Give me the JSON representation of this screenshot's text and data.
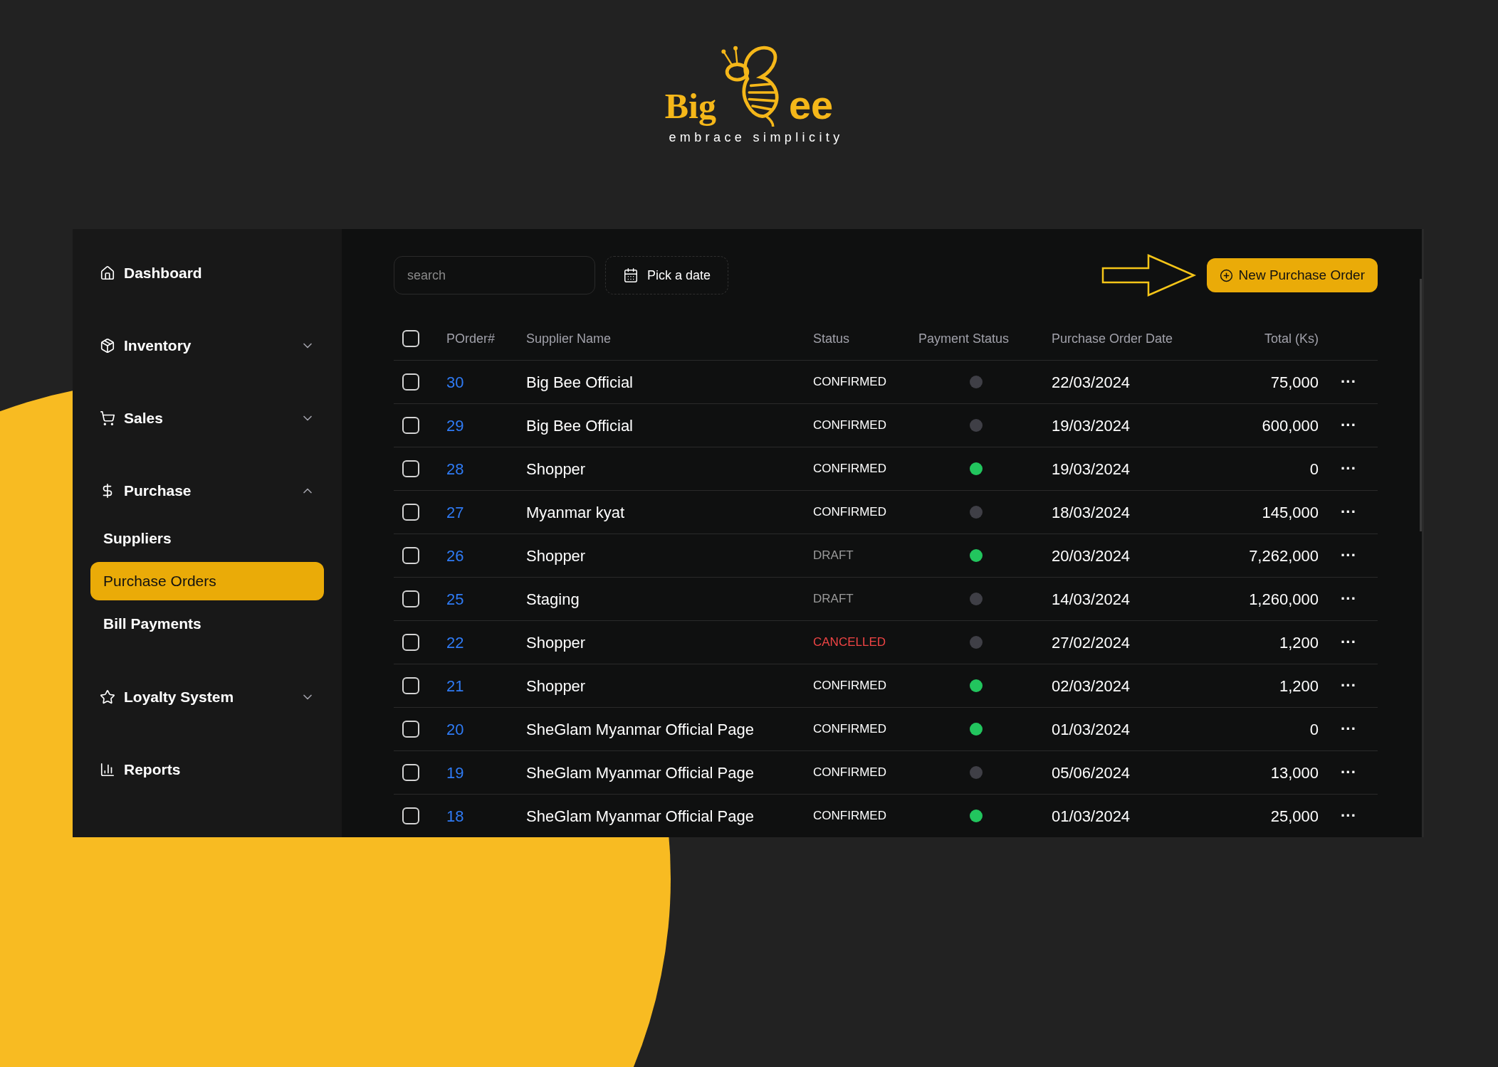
{
  "logo": {
    "word_left": "Big",
    "word_right": "ee",
    "tagline": "embrace simplicity"
  },
  "sidebar": {
    "items": [
      {
        "label": "Dashboard"
      },
      {
        "label": "Inventory",
        "expanded": false
      },
      {
        "label": "Sales",
        "expanded": false
      },
      {
        "label": "Purchase",
        "expanded": true,
        "children": [
          {
            "label": "Suppliers",
            "selected": false
          },
          {
            "label": "Purchase Orders",
            "selected": true
          },
          {
            "label": "Bill Payments",
            "selected": false
          }
        ]
      },
      {
        "label": "Loyalty System",
        "expanded": false
      },
      {
        "label": "Reports"
      }
    ]
  },
  "toolbar": {
    "search": {
      "placeholder": "search"
    },
    "date_button": "Pick a date",
    "new_button": "New Purchase Order"
  },
  "table": {
    "all_checked": false,
    "columns": [
      "POrder#",
      "Supplier Name",
      "Status",
      "Payment Status",
      "Purchase Order Date",
      "Total (Ks)"
    ],
    "rows": [
      {
        "checked": false,
        "porder": "30",
        "supplier": "Big Bee Official",
        "status": {
          "text": "CONFIRMED",
          "kind": "confirmed"
        },
        "color": "#3f3f46",
        "date": "22/03/2024",
        "total": "75,000",
        "menu": "···"
      },
      {
        "checked": false,
        "porder": "29",
        "supplier": "Big Bee Official",
        "status": {
          "text": "CONFIRMED",
          "kind": "confirmed"
        },
        "color": "#3f3f46",
        "date": "19/03/2024",
        "total": "600,000",
        "menu": "···"
      },
      {
        "checked": false,
        "porder": "28",
        "supplier": "Shopper",
        "status": {
          "text": "CONFIRMED",
          "kind": "confirmed"
        },
        "color": "#22c55e",
        "date": "19/03/2024",
        "total": "0",
        "menu": "···"
      },
      {
        "checked": false,
        "porder": "27",
        "supplier": "Myanmar kyat",
        "status": {
          "text": "CONFIRMED",
          "kind": "confirmed"
        },
        "color": "#3f3f46",
        "date": "18/03/2024",
        "total": "145,000",
        "menu": "···"
      },
      {
        "checked": false,
        "porder": "26",
        "supplier": "Shopper",
        "status": {
          "text": "DRAFT",
          "kind": "draft"
        },
        "color": "#22c55e",
        "date": "20/03/2024",
        "total": "7,262,000",
        "menu": "···"
      },
      {
        "checked": false,
        "porder": "25",
        "supplier": "Staging",
        "status": {
          "text": "DRAFT",
          "kind": "draft"
        },
        "color": "#3f3f46",
        "date": "14/03/2024",
        "total": "1,260,000",
        "menu": "···"
      },
      {
        "checked": false,
        "porder": "22",
        "supplier": "Shopper",
        "status": {
          "text": "CANCELLED",
          "kind": "cancelled"
        },
        "color": "#3f3f46",
        "date": "27/02/2024",
        "total": "1,200",
        "menu": "···"
      },
      {
        "checked": false,
        "porder": "21",
        "supplier": "Shopper",
        "status": {
          "text": "CONFIRMED",
          "kind": "confirmed"
        },
        "color": "#22c55e",
        "date": "02/03/2024",
        "total": "1,200",
        "menu": "···"
      },
      {
        "checked": false,
        "porder": "20",
        "supplier": "SheGlam Myanmar Official Page",
        "status": {
          "text": "CONFIRMED",
          "kind": "confirmed"
        },
        "color": "#22c55e",
        "date": "01/03/2024",
        "total": "0",
        "menu": "···"
      },
      {
        "checked": false,
        "porder": "19",
        "supplier": "SheGlam Myanmar Official Page",
        "status": {
          "text": "CONFIRMED",
          "kind": "confirmed"
        },
        "color": "#3f3f46",
        "date": "05/06/2024",
        "total": "13,000",
        "menu": "···"
      },
      {
        "checked": false,
        "porder": "18",
        "supplier": "SheGlam Myanmar Official Page",
        "status": {
          "text": "CONFIRMED",
          "kind": "confirmed"
        },
        "color": "#22c55e",
        "date": "01/03/2024",
        "total": "25,000",
        "menu": "···"
      }
    ]
  }
}
